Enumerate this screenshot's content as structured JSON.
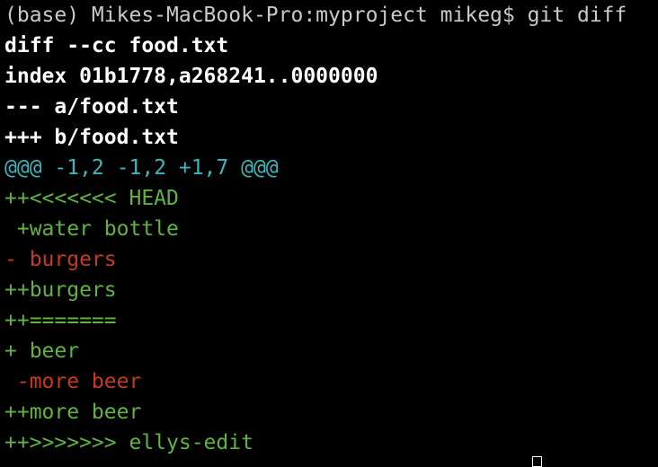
{
  "terminal": {
    "lines": [
      {
        "text": "(base) Mikes-MacBook-Pro:myproject mikeg$ git diff",
        "kind": "prompt"
      },
      {
        "text": "diff --cc food.txt",
        "kind": "meta"
      },
      {
        "text": "index 01b1778,a268241..0000000",
        "kind": "meta"
      },
      {
        "text": "--- a/food.txt",
        "kind": "meta"
      },
      {
        "text": "+++ b/food.txt",
        "kind": "meta"
      },
      {
        "text": "@@@ -1,2 -1,2 +1,7 @@@",
        "kind": "hunk"
      },
      {
        "text": "++<<<<<<< HEAD",
        "kind": "added"
      },
      {
        "text": " +water bottle",
        "kind": "added"
      },
      {
        "text": "- burgers",
        "kind": "removed"
      },
      {
        "text": "++burgers",
        "kind": "added"
      },
      {
        "text": "++=======",
        "kind": "added"
      },
      {
        "text": "+ beer",
        "kind": "added"
      },
      {
        "text": " -more beer",
        "kind": "removed"
      },
      {
        "text": "++more beer",
        "kind": "added"
      },
      {
        "text": "++>>>>>>> ellys-edit",
        "kind": "added"
      }
    ]
  },
  "colors": {
    "background": "#000000",
    "prompt": "#c9c9c9",
    "meta": "#ffffff",
    "hunk": "#3bb6bd",
    "added": "#5fb441",
    "removed": "#c63a22"
  }
}
